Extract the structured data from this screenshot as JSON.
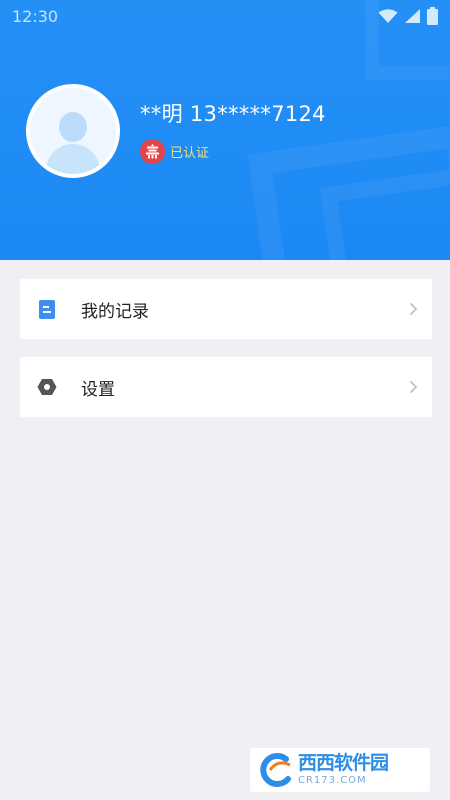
{
  "status_bar": {
    "time": "12:30",
    "icons": [
      "wifi-icon",
      "signal-icon",
      "battery-icon"
    ]
  },
  "profile": {
    "name": "**明 13*****7124",
    "verified_label": "已认证",
    "avatar_icon": "avatar-placeholder-icon",
    "badge_icon": "emblem-icon"
  },
  "menu": {
    "items": [
      {
        "label": "我的记录",
        "icon": "document-icon"
      },
      {
        "label": "设置",
        "icon": "hexagon-settings-icon"
      }
    ]
  },
  "watermark": {
    "brand_cn": "西西软件园",
    "url": "CR173.COM"
  },
  "colors": {
    "header_blue": "#1c88f4",
    "page_bg": "#efeff4",
    "verify_badge": "#e2464b",
    "verify_text": "#f6e26c",
    "menu_icon_blue": "#3d8cf0",
    "menu_icon_gray": "#555555"
  }
}
